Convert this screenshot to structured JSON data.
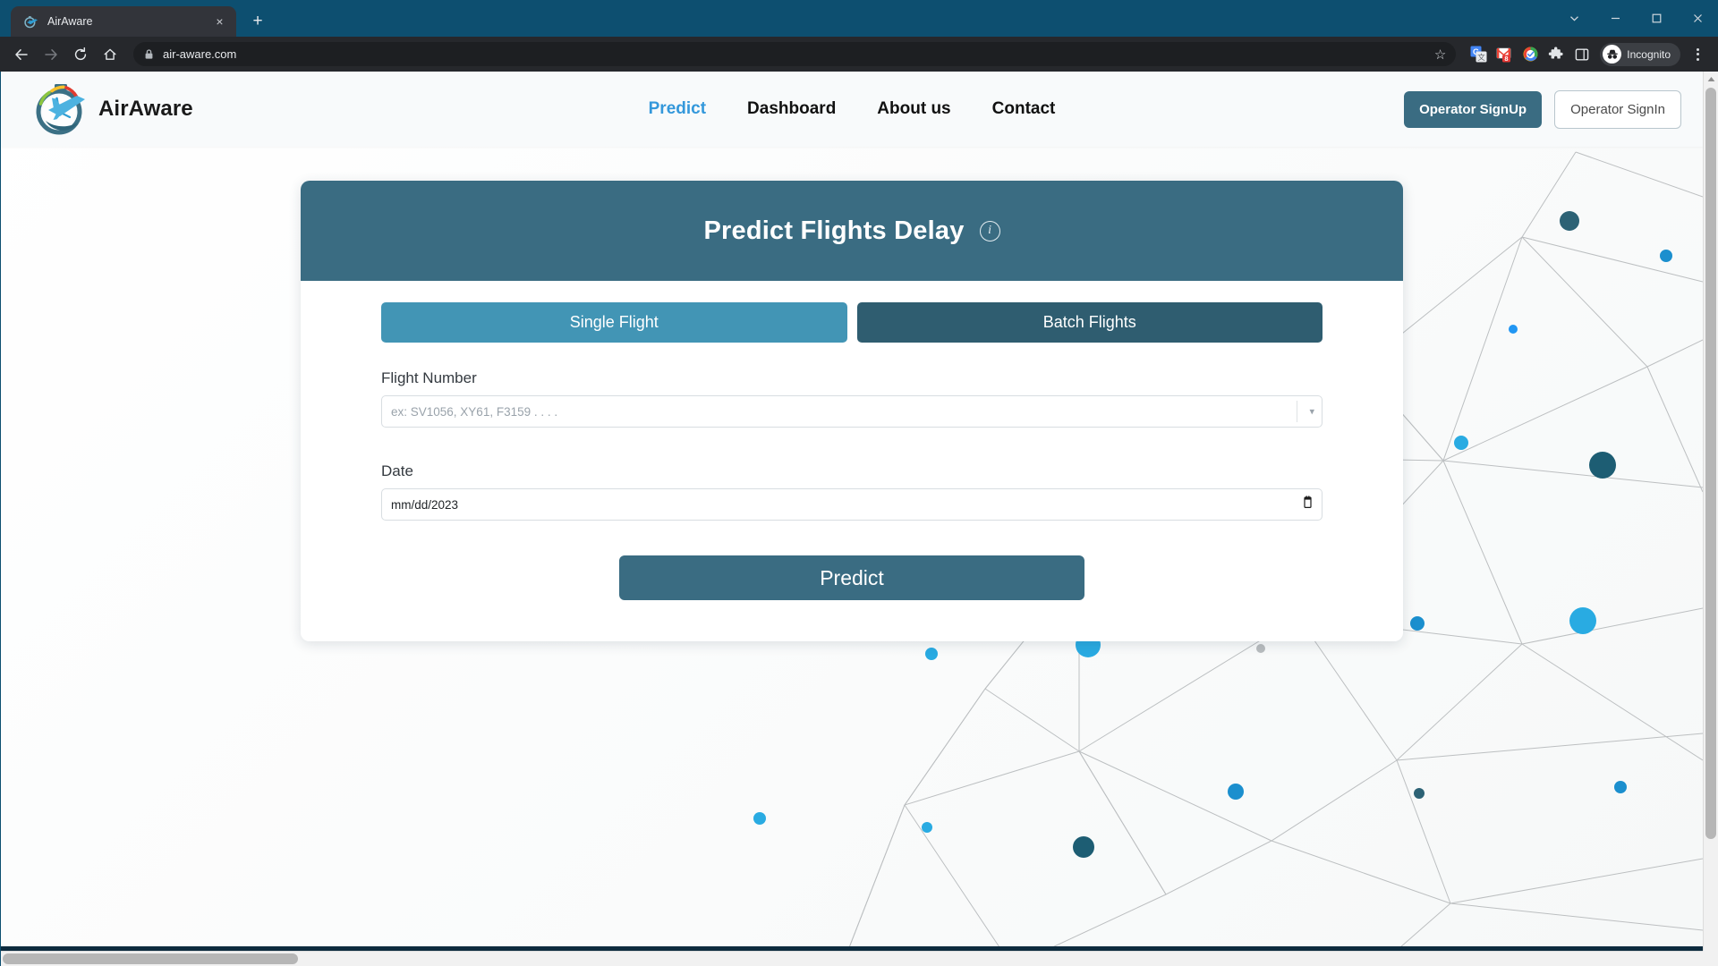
{
  "browser": {
    "tab": {
      "title": "AirAware",
      "favicon": "airaware-stopwatch-plane-icon",
      "close_label": "×"
    },
    "new_tab_label": "+",
    "window_controls": {
      "collapse": "chevron-down-icon",
      "minimize": "minimize-icon",
      "maximize": "maximize-icon",
      "close": "close-icon"
    },
    "toolbar": {
      "back": "back-arrow-icon",
      "forward": "forward-arrow-icon",
      "reload": "reload-icon",
      "home": "home-icon",
      "url": "air-aware.com",
      "lock": "lock-icon",
      "bookmark": "star-icon",
      "extensions": [
        {
          "name": "google-translate-icon",
          "label": "G"
        },
        {
          "name": "gmail-icon",
          "label": "M",
          "badge": "8"
        },
        {
          "name": "color-wheel-icon",
          "label": ""
        },
        {
          "name": "puzzle-extensions-icon",
          "label": ""
        },
        {
          "name": "side-panel-icon",
          "label": ""
        }
      ],
      "profile": {
        "label": "Incognito",
        "icon": "incognito-icon"
      },
      "menu": "kebab-menu-icon"
    }
  },
  "site": {
    "brand": {
      "name": "AirAware",
      "logo": "stopwatch-airplane-logo"
    },
    "nav": [
      {
        "label": "Predict",
        "active": true
      },
      {
        "label": "Dashboard",
        "active": false
      },
      {
        "label": "About us",
        "active": false
      },
      {
        "label": "Contact",
        "active": false
      }
    ],
    "auth": {
      "signup_label": "Operator SignUp",
      "signin_label": "Operator SignIn"
    }
  },
  "card": {
    "title": "Predict Flights Delay",
    "info_icon": "info-circle-icon",
    "tabs": [
      {
        "label": "Single Flight",
        "active": true
      },
      {
        "label": "Batch Flights",
        "active": false
      }
    ],
    "flight_number": {
      "label": "Flight Number",
      "placeholder": "ex: SV1056, XY61, F3159 . . . .",
      "value": ""
    },
    "date": {
      "label": "Date",
      "value": "mm/dd/2023"
    },
    "submit_label": "Predict"
  },
  "colors": {
    "brand_teal": "#3a6c82",
    "accent_blue": "#3498db",
    "tab_active": "#4295b5",
    "tab_inactive": "#2f5d70",
    "browser_frame": "#0d4f70",
    "node_light": "#29abe2",
    "node_dark": "#2d6275"
  },
  "chrome_title_bar_color": "#0d4f70"
}
